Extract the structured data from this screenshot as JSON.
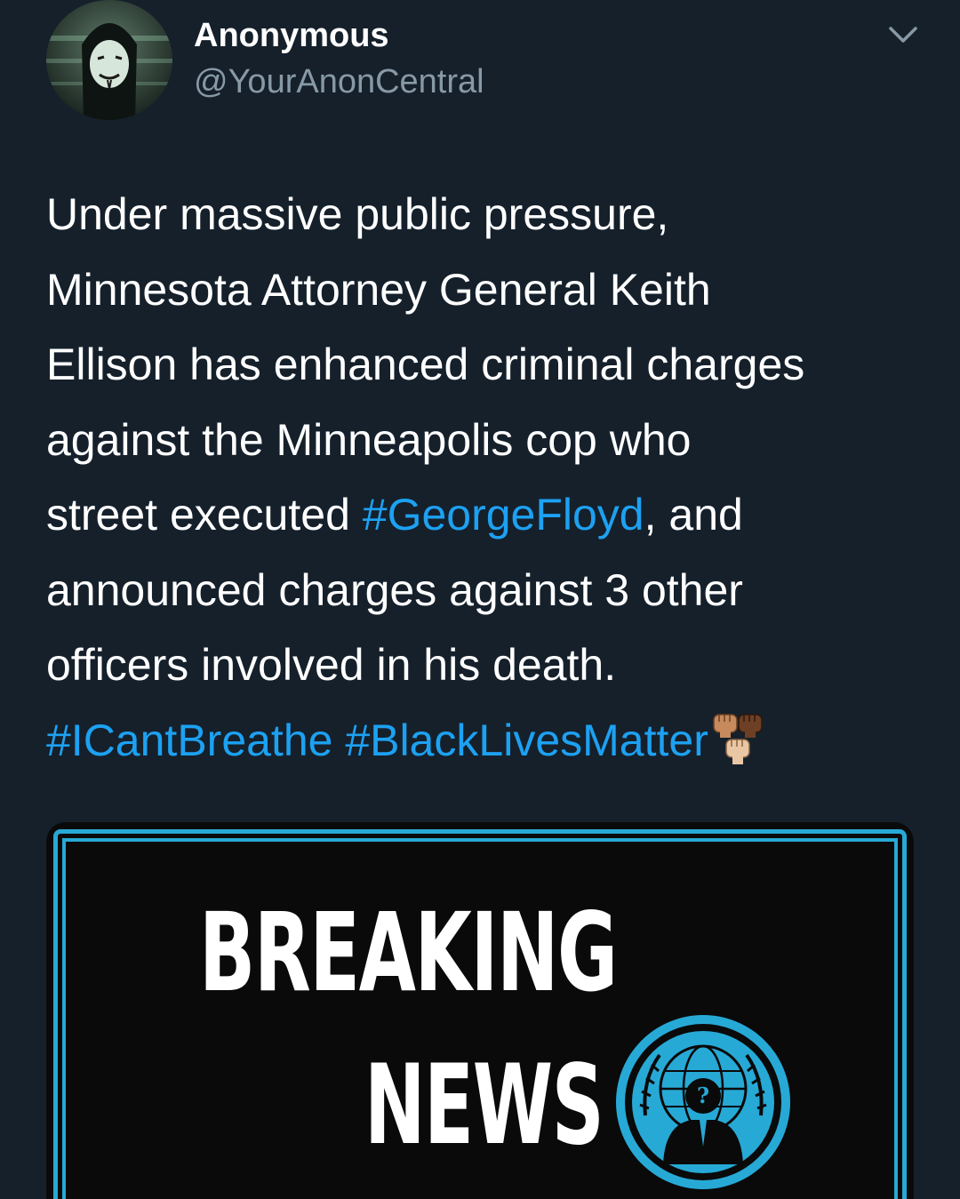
{
  "tweet": {
    "display_name": "Anonymous",
    "handle": "@YourAnonCentral",
    "lines": [
      [
        "Under massive public pressure,"
      ],
      [
        "Minnesota Attorney General Keith"
      ],
      [
        "Ellison has enhanced criminal charges"
      ],
      [
        "against the Minneapolis cop who"
      ],
      [
        "street executed ",
        "#GeorgeFloyd",
        ", and"
      ],
      [
        "announced charges against 3 other"
      ],
      [
        "officers involved in his death."
      ],
      [
        "#ICantBreathe",
        " ",
        "#BlackLivesMatter"
      ]
    ],
    "emoji": "raised-fists-icon"
  },
  "media": {
    "headline_line1": "BREAKING",
    "headline_line2": "NEWS",
    "logo": "anonymous-logo-icon",
    "logo_glyph": "?",
    "border_color": "#27a9d6"
  },
  "colors": {
    "background": "#15202b",
    "hashtag": "#1da1f2",
    "secondary_text": "#8899a6"
  }
}
